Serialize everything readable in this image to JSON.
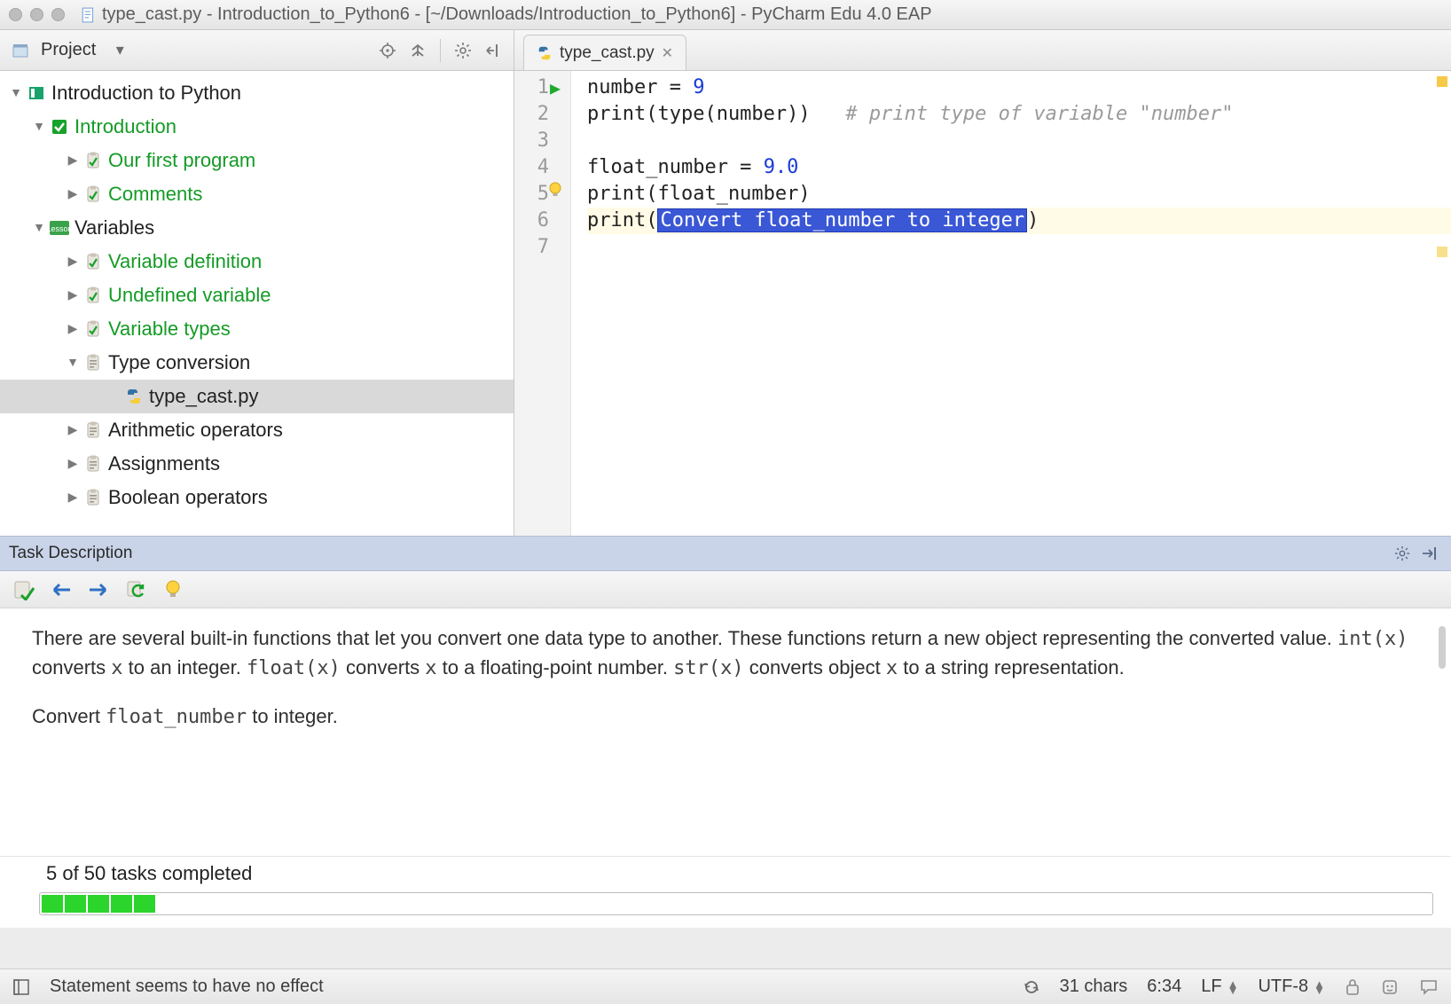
{
  "window": {
    "title": "type_cast.py - Introduction_to_Python6 - [~/Downloads/Introduction_to_Python6] - PyCharm Edu 4.0 EAP"
  },
  "project": {
    "label": "Project",
    "tree": {
      "root": "Introduction to Python",
      "intro": {
        "label": "Introduction",
        "items": [
          "Our first program",
          "Comments"
        ]
      },
      "variables": {
        "label": "Variables",
        "items": [
          "Variable definition",
          "Undefined variable",
          "Variable types"
        ],
        "type_conversion": {
          "label": "Type conversion",
          "file": "type_cast.py"
        },
        "rest": [
          "Arithmetic operators",
          "Assignments",
          "Boolean operators"
        ]
      }
    }
  },
  "tab": {
    "label": "type_cast.py"
  },
  "editor": {
    "gutter": [
      "1",
      "2",
      "3",
      "4",
      "5",
      "6",
      "7"
    ],
    "lines": {
      "l1_a": "number = ",
      "l1_b": "9",
      "l2_a": "print(type(number))   ",
      "l2_b": "# print type of variable \"number\"",
      "l3": "",
      "l4_a": "float_number = ",
      "l4_b": "9.0",
      "l5": "print(float_number)",
      "l6_a": "print(",
      "l6_ph": "Convert float_number to integer",
      "l6_b": ")",
      "l7": ""
    }
  },
  "task": {
    "header": "Task Description",
    "body_p1a": "There are several built-in functions that let you convert one data type to another. These functions return a new object representing the converted value. ",
    "body_p1b": " converts ",
    "body_p1c": " to an integer. ",
    "body_p1d": " converts ",
    "body_p1e": " to a floating-point number. ",
    "body_p1f": " converts object ",
    "body_p1g": " to a string representation.",
    "code_int": "int(x)",
    "code_x": "x",
    "code_float": "float(x)",
    "code_str": "str(x)",
    "body_p2a": "Convert ",
    "body_p2_code": "float_number",
    "body_p2b": " to integer.",
    "progress_label": "5 of 50 tasks completed"
  },
  "status": {
    "message": "Statement seems to have no effect",
    "chars": "31 chars",
    "pos": "6:34",
    "line_sep": "LF",
    "encoding": "UTF-8"
  }
}
